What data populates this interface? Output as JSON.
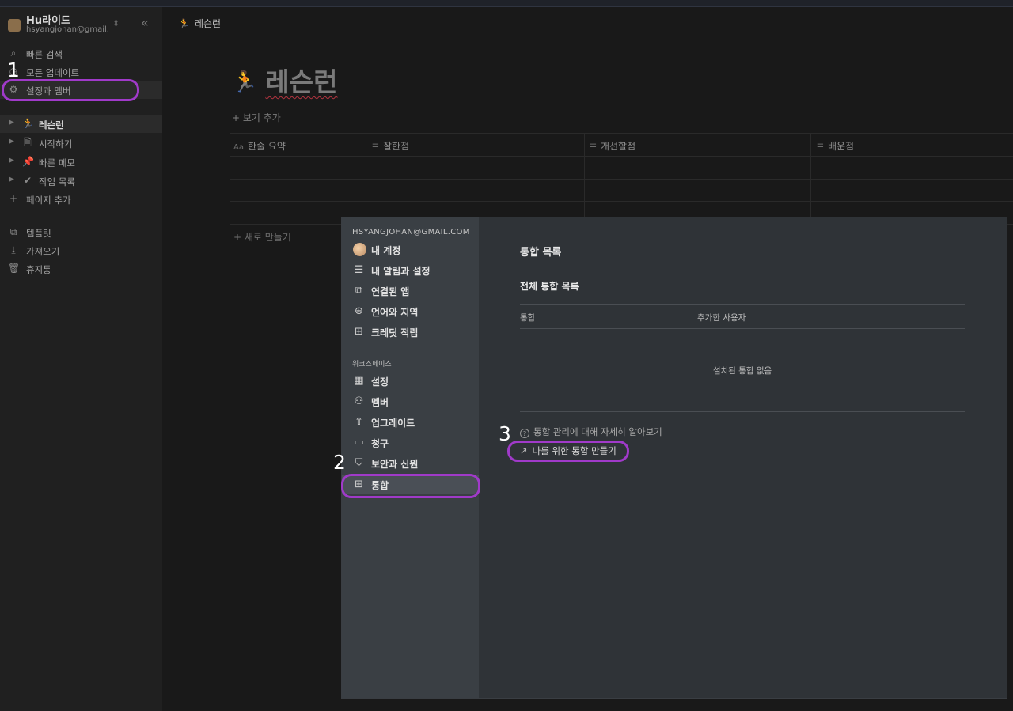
{
  "workspace": {
    "name": "Hu라이드",
    "email": "hsyangjohan@gmail....",
    "switch_icon": "chevron-up-down-icon",
    "collapse_icon": "double-chevron-left-icon"
  },
  "sidebar": {
    "quick": [
      {
        "label": "빠른 검색",
        "icon": "search-icon"
      },
      {
        "label": "모든 업데이트",
        "icon": "clock-icon"
      },
      {
        "label": "설정과 멤버",
        "icon": "gear-icon"
      }
    ],
    "pages": [
      {
        "label": "레슨런",
        "icon": "runner-icon",
        "selected": true
      },
      {
        "label": "시작하기",
        "icon": "page-icon"
      },
      {
        "label": "빠른 메모",
        "icon": "pin-icon"
      },
      {
        "label": "작업 목록",
        "icon": "check-icon"
      }
    ],
    "add_page": "페이지 추가",
    "bottom": [
      {
        "label": "템플릿",
        "icon": "template-icon"
      },
      {
        "label": "가져오기",
        "icon": "import-icon"
      },
      {
        "label": "휴지통",
        "icon": "trash-icon"
      }
    ]
  },
  "annotations": [
    "1",
    "2",
    "3"
  ],
  "main": {
    "breadcrumb": "레슨런",
    "title": "레슨런",
    "add_view": "보기 추가",
    "columns": [
      "한줄 요약",
      "잘한점",
      "개선할점",
      "배운점"
    ],
    "new_row": "새로 만들기"
  },
  "modal": {
    "email": "HSYANGJOHAN@GMAIL.COM",
    "account_items": [
      {
        "label": "내 계정",
        "icon": "avatar-icon"
      },
      {
        "label": "내 알림과 설정",
        "icon": "sliders-icon"
      },
      {
        "label": "연결된 앱",
        "icon": "arrow-box-icon"
      },
      {
        "label": "언어와 지역",
        "icon": "globe-icon"
      },
      {
        "label": "크레딧 적립",
        "icon": "gift-icon"
      }
    ],
    "workspace_section": "워크스페이스",
    "workspace_items": [
      {
        "label": "설정",
        "icon": "building-icon"
      },
      {
        "label": "멤버",
        "icon": "members-icon"
      },
      {
        "label": "업그레이드",
        "icon": "upgrade-icon"
      },
      {
        "label": "청구",
        "icon": "card-icon"
      },
      {
        "label": "보안과 신원",
        "icon": "shield-icon"
      },
      {
        "label": "통합",
        "icon": "grid-icon",
        "selected": true
      }
    ],
    "content": {
      "title": "통합 목록",
      "subtitle": "전체 통합 목록",
      "col_integration": "통합",
      "col_added_by": "추가한 사용자",
      "empty": "설치된 통합 없음",
      "learn_more": "통합 관리에 대해 자세히 알아보기",
      "create_link": "나를 위한 통합 만들기"
    }
  },
  "colors": {
    "annotation_ring": "#a03ac9",
    "background": "#191919",
    "sidebar": "#202020",
    "modal": "#2f3337",
    "modal_sidebar": "#3a3f44"
  }
}
